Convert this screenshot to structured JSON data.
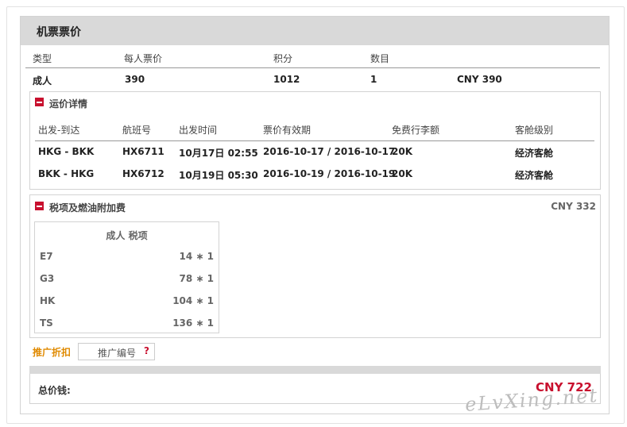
{
  "section_title": "机票票价",
  "fare_table": {
    "headers": [
      "类型",
      "每人票价",
      "积分",
      "数目"
    ],
    "row": {
      "type": "成人",
      "price": "390",
      "points": "1012",
      "count": "1",
      "total": "CNY 390"
    }
  },
  "fare_details": {
    "title": "运价详情",
    "headers": [
      "出发-到达",
      "航班号",
      "出发时间",
      "票价有效期",
      "免费行李额",
      "客舱级别"
    ],
    "rows": [
      {
        "route": "HKG - BKK",
        "flight": "HX6711",
        "departure": "10月17日 02:55",
        "validity": "2016-10-17 / 2016-10-17",
        "baggage": "20K",
        "cabin": "经济客舱"
      },
      {
        "route": "BKK - HKG",
        "flight": "HX6712",
        "departure": "10月19日 05:30",
        "validity": "2016-10-19 / 2016-10-19",
        "baggage": "20K",
        "cabin": "经济客舱"
      }
    ]
  },
  "taxes": {
    "title": "税项及燃油附加费",
    "total": "CNY 332",
    "table_title": "成人 税项",
    "rows": [
      {
        "code": "E7",
        "value": "14 ∗ 1"
      },
      {
        "code": "G3",
        "value": "78 ∗ 1"
      },
      {
        "code": "HK",
        "value": "104 ∗ 1"
      },
      {
        "code": "TS",
        "value": "136 ∗ 1"
      }
    ]
  },
  "promo": {
    "label": "推广折扣",
    "placeholder": "推广编号",
    "help": "?"
  },
  "total": {
    "label": "总价钱:",
    "value": "CNY 722"
  },
  "watermark": "eLvXing.net",
  "colors": {
    "accent_red": "#c8102e",
    "promo_orange": "#e08a00",
    "header_gray": "#d9d9d9"
  }
}
